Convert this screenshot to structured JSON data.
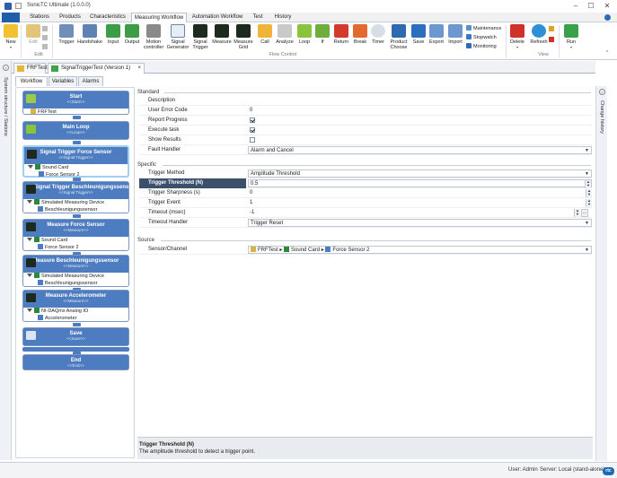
{
  "window": {
    "title": "SonicTC Ultimate (1.0.0.0)",
    "minimize": "–",
    "maximize": "☐",
    "close": "✕"
  },
  "menu": {
    "tabs": [
      "Stations",
      "Products",
      "Characteristics",
      "Measuring Workflow",
      "Automation Workflow",
      "Test",
      "History"
    ],
    "active": "Measuring Workflow"
  },
  "ribbon": {
    "new": "New",
    "edit": "Edit",
    "edit_group": "Edit",
    "tools": [
      "Trigger",
      "Handshake",
      "Input",
      "Output",
      "Motion controller",
      "Signal Generator",
      "Signal Trigger",
      "Measure",
      "Measure Grid",
      "Call",
      "Analyze",
      "Loop",
      "If",
      "Return",
      "Break",
      "Timer",
      "Product Choose",
      "Save",
      "Export",
      "Import"
    ],
    "flow_group": "Flow Control",
    "view_items": [
      "Maintenance",
      "Stopwatch",
      "Monitoring"
    ],
    "delete": "Delete",
    "refresh": "Refresh",
    "view_group": "View",
    "run": "Run"
  },
  "side": {
    "left": "System structure / Stations",
    "right": "Change history"
  },
  "doc_tabs": [
    "FRFTest",
    "SignalTriggerTest (Version 1)"
  ],
  "doc_close": "×",
  "sub_tabs": [
    "Workflow",
    "Variables",
    "Alarms"
  ],
  "workflow": [
    {
      "title": "Start",
      "sub": "<<Start>>",
      "rows": [
        {
          "indent": 0,
          "text": "FRFTest"
        }
      ]
    },
    {
      "title": "Main Loop",
      "sub": "<<Loop>>",
      "rows": []
    },
    {
      "title": "Signal Trigger Force Sensor",
      "sub": "<<Signal Trigger>>",
      "rows": [
        {
          "indent": 0,
          "text": "Sound Card"
        },
        {
          "indent": 1,
          "text": "Force Sensor 2"
        }
      ]
    },
    {
      "title": "Signal Trigger Beschleunigungssensor",
      "sub": "<<Signal Trigger>>",
      "rows": [
        {
          "indent": 0,
          "text": "Simulated Measuring Device"
        },
        {
          "indent": 1,
          "text": "Beschleunigungssensor"
        }
      ]
    },
    {
      "title": "Measure Force Sensor",
      "sub": "<<Measure>>",
      "rows": [
        {
          "indent": 0,
          "text": "Sound Card"
        },
        {
          "indent": 1,
          "text": "Force Sensor 2"
        }
      ]
    },
    {
      "title": "Measure Beschleunigungssensor",
      "sub": "<<Measure>>",
      "rows": [
        {
          "indent": 0,
          "text": "Simulated Measuring Device"
        },
        {
          "indent": 1,
          "text": "Beschleunigungssensor"
        }
      ]
    },
    {
      "title": "Measure Accelerometer",
      "sub": "<<Measure>>",
      "rows": [
        {
          "indent": 0,
          "text": "NI-DAQmx Analog IO"
        },
        {
          "indent": 1,
          "text": "Accelerometer"
        }
      ]
    },
    {
      "title": "Save",
      "sub": "<<Save>>",
      "rows": []
    },
    {
      "title": "End",
      "sub": "<<End>>",
      "rows": []
    }
  ],
  "props": {
    "standard": "Standard",
    "description": {
      "label": "Description",
      "value": ""
    },
    "user_error_code": {
      "label": "User Error Code",
      "value": "0"
    },
    "report_progress": {
      "label": "Report Progress",
      "checked": true
    },
    "execute_task": {
      "label": "Execute task",
      "checked": true
    },
    "show_results": {
      "label": "Show Results",
      "checked": false
    },
    "fault_handler": {
      "label": "Fault Handler",
      "value": "Alarm and Cancel"
    },
    "specific": "Specific",
    "trigger_method": {
      "label": "Trigger Method",
      "value": "Amplitude Threshold"
    },
    "trigger_threshold": {
      "label": "Trigger Threshold (N)",
      "value": "0.5"
    },
    "trigger_sharpness": {
      "label": "Trigger Sharpness (s)",
      "value": "0"
    },
    "trigger_event": {
      "label": "Trigger Event",
      "value": "1"
    },
    "timeout": {
      "label": "Timeout (msec)",
      "value": "-1"
    },
    "timeout_handler": {
      "label": "Timeout Handler",
      "value": "Trigger Reset"
    },
    "source": "Source",
    "sensor_channel": {
      "label": "Sensor/Channel",
      "path": [
        "FRFTest",
        "Sound Card",
        "Force Sensor 2"
      ]
    }
  },
  "help": {
    "title": "Trigger Threshold (N)",
    "desc": "The amplitude threshold to detect a trigger point."
  },
  "status": {
    "user": "User: Admin",
    "server": "Server: Local (stand-alone)",
    "logo": "rtc"
  }
}
